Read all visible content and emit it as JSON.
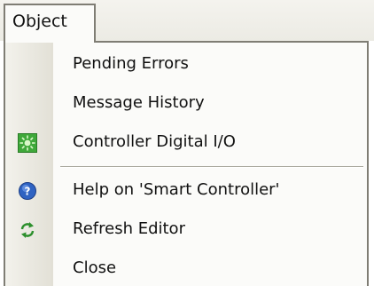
{
  "menu": {
    "title": "Object",
    "items": [
      {
        "label": "Pending Errors",
        "icon": null
      },
      {
        "label": "Message History",
        "icon": null
      },
      {
        "label": "Controller Digital I/O",
        "icon": "green-io-chip-icon"
      },
      {
        "label": "Help on 'Smart Controller'",
        "icon": "help-question-icon"
      },
      {
        "label": "Refresh Editor",
        "icon": "refresh-arrows-icon"
      },
      {
        "label": "Close",
        "icon": null
      }
    ]
  },
  "colors": {
    "menu_background": "#fbfbf9",
    "border": "#7f7d74",
    "gutter": "#e8e6dd",
    "io_icon": "#3fa83a",
    "help_icon": "#2f63c2",
    "refresh_icon": "#2c8f2c"
  }
}
